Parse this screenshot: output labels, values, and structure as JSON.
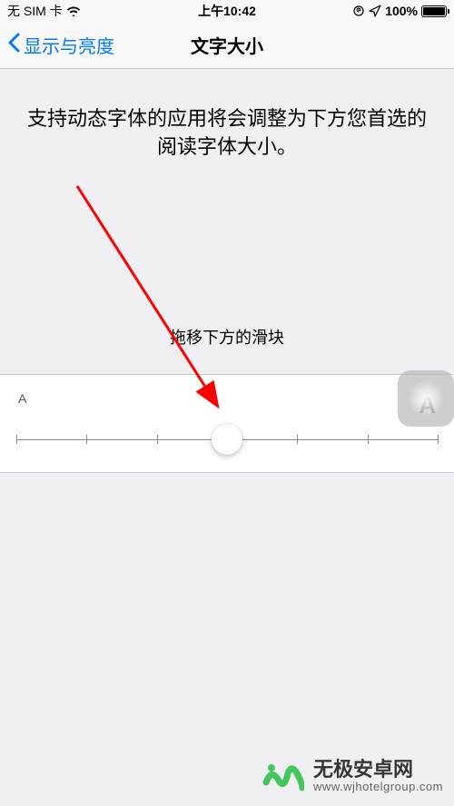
{
  "status": {
    "carrier": "无 SIM 卡",
    "time": "上午10:42",
    "battery_pct": "100%"
  },
  "nav": {
    "back_label": "显示与亮度",
    "title": "文字大小"
  },
  "description": "支持动态字体的应用将会调整为下方您首选的阅读字体大小。",
  "slider": {
    "hint": "拖移下方的滑块",
    "small_label": "A",
    "big_label": "A",
    "ticks": 7,
    "value_index": 3
  },
  "watermark": {
    "brand_cn": "无极安卓网",
    "url": "www.wjhotelgroup.com"
  }
}
